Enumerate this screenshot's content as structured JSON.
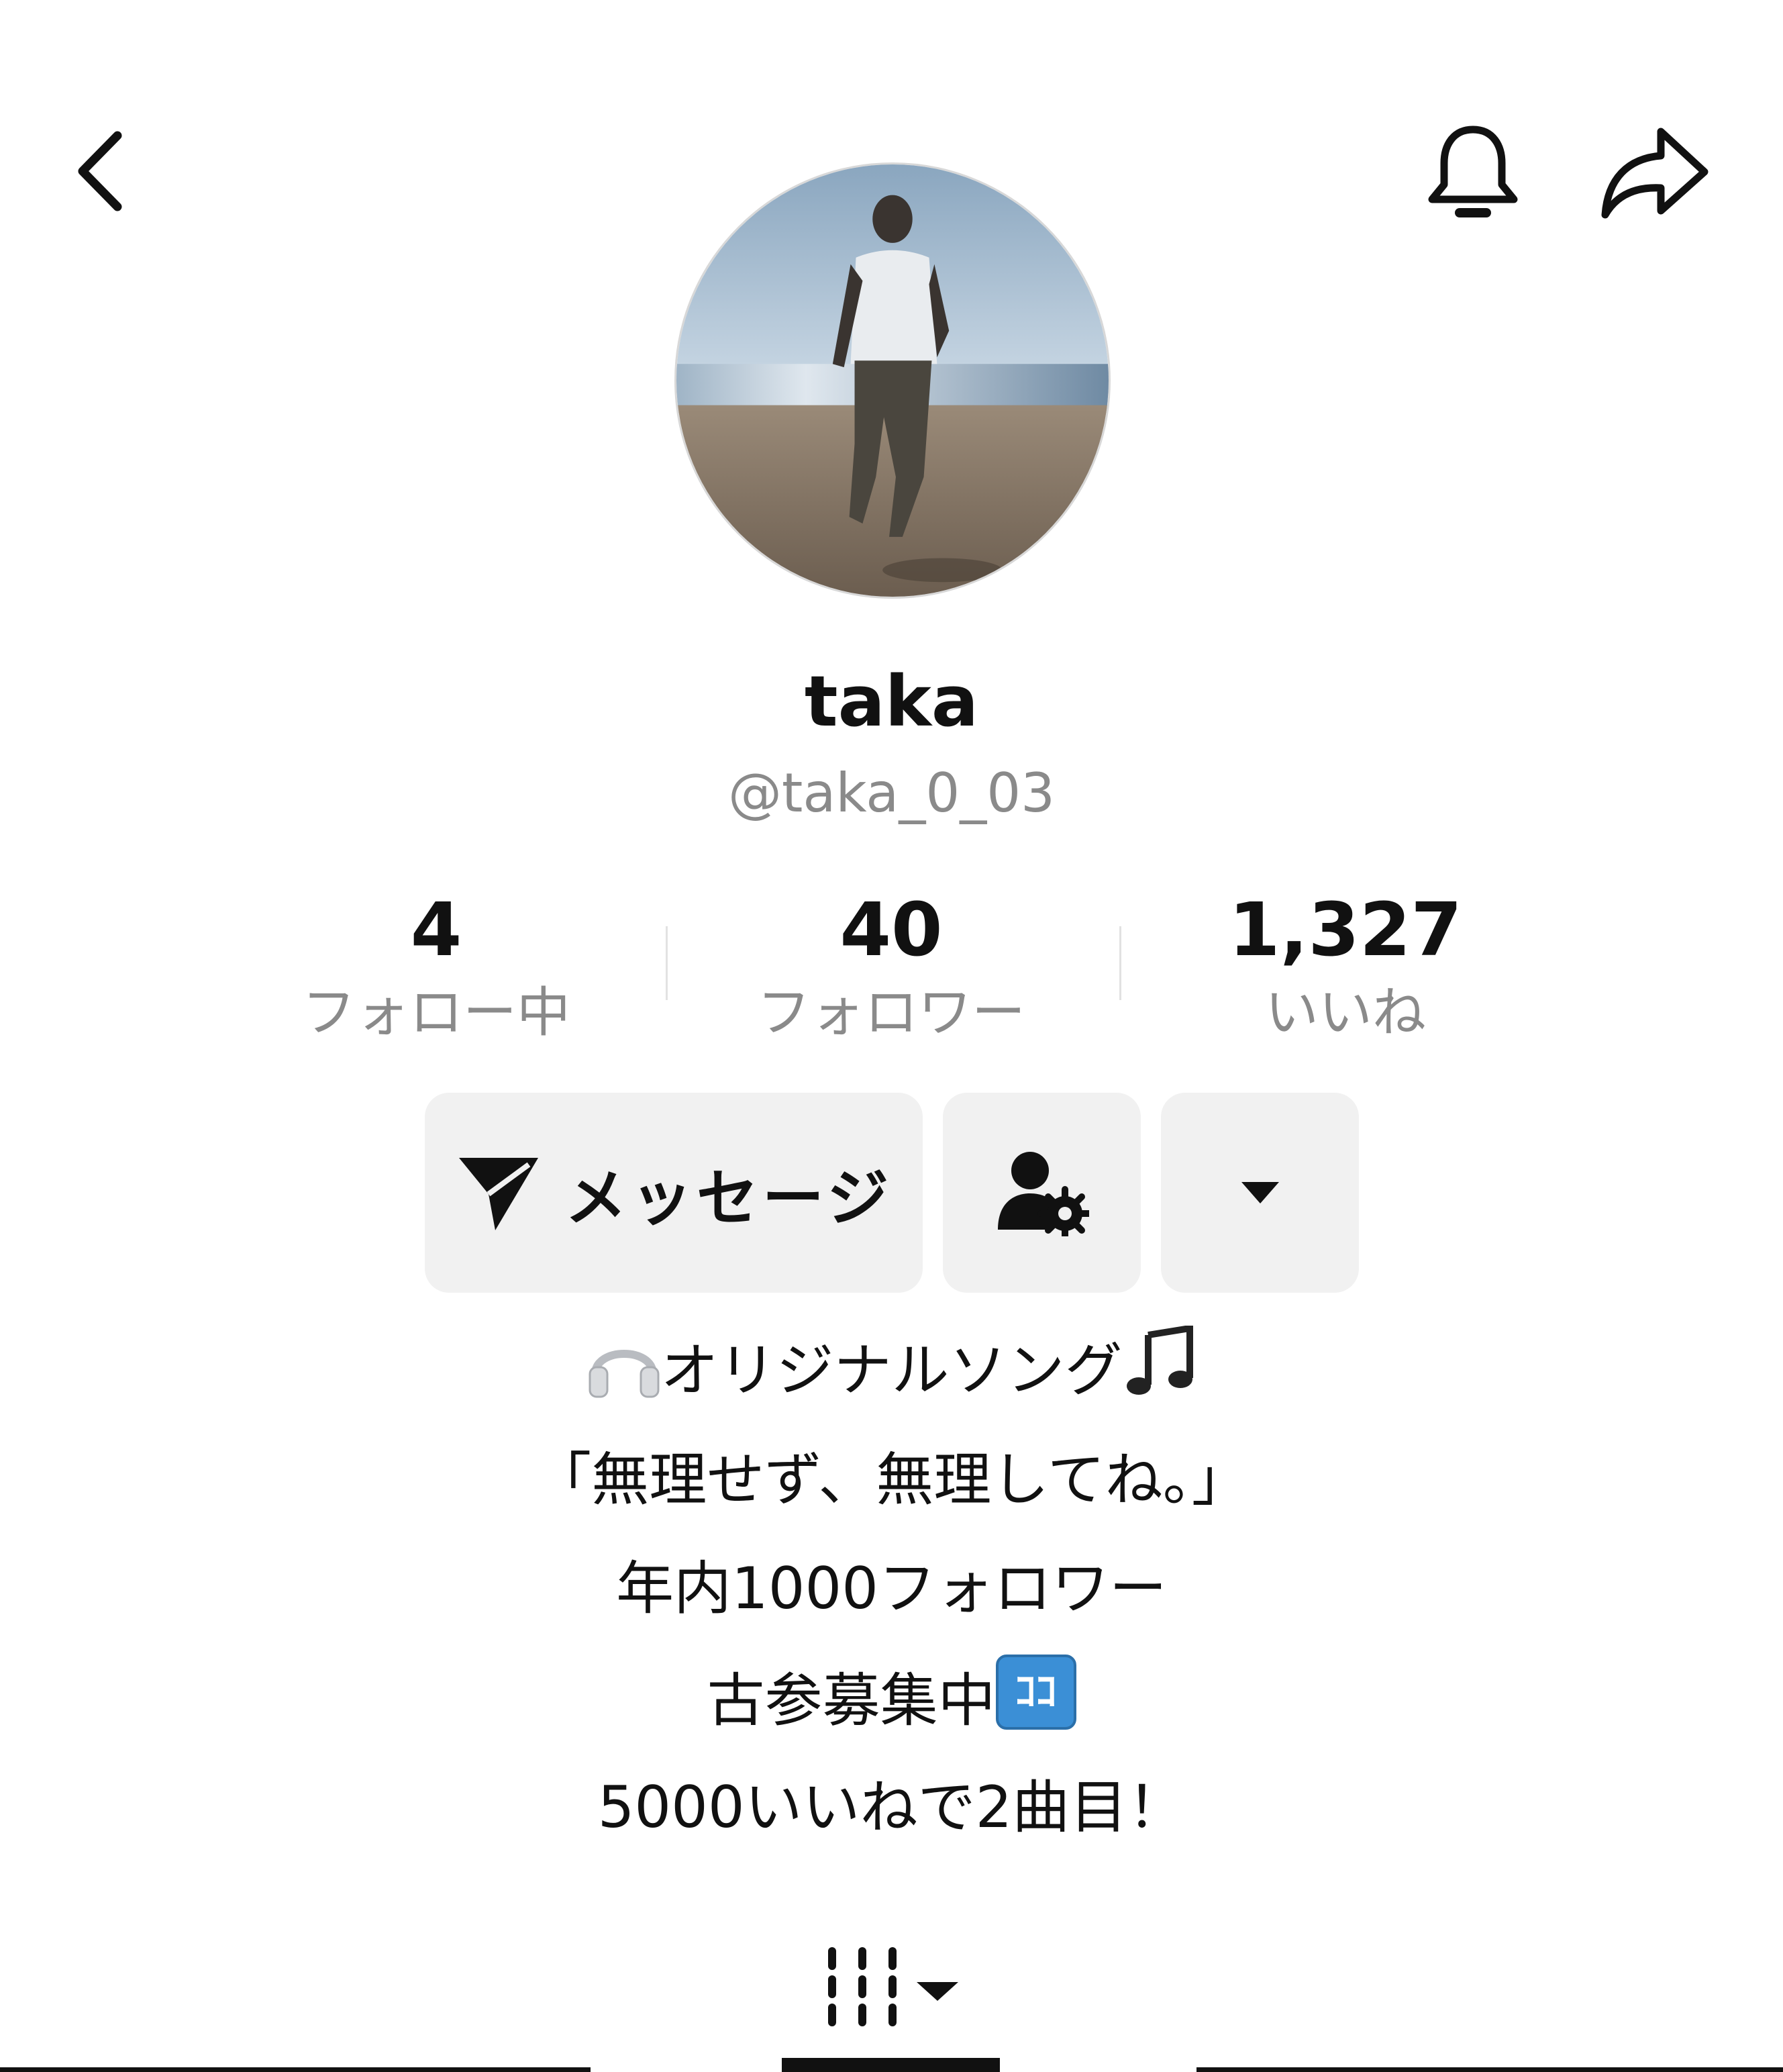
{
  "header": {
    "back_icon": "chevron-left-icon",
    "notification_icon": "bell-icon",
    "share_icon": "share-arrow-icon"
  },
  "profile": {
    "display_name": "taka",
    "username": "@taka_0_03"
  },
  "stats": [
    {
      "value": "4",
      "label": "フォロー中"
    },
    {
      "value": "40",
      "label": "フォロワー"
    },
    {
      "value": "1,327",
      "label": "いいね"
    }
  ],
  "actions": {
    "message_label": "メッセージ",
    "message_icon": "send-icon",
    "friend_icon": "user-settings-icon",
    "more_icon": "caret-down-icon"
  },
  "bio": {
    "line1_text": "オリジナルソング",
    "line1_prefix_emoji": "headphones-icon",
    "line1_suffix_emoji": "music-notes-icon",
    "line2": "「無理せず、無理してね。」",
    "line3": "年内1000フォロワー",
    "line4_text": "古参募集中",
    "line4_badge": "ｺｺ",
    "line5": "5000いいねで2曲目！"
  },
  "tabs": {
    "videos_icon": "grid-icon",
    "badge_color": "#3b8fd6"
  }
}
